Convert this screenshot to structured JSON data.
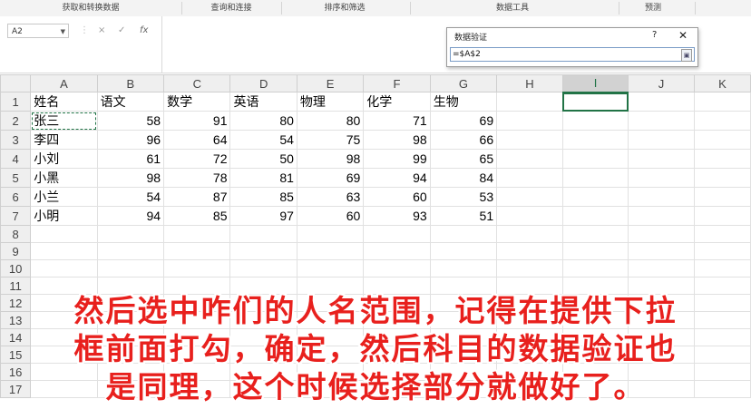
{
  "ribbon": {
    "groups": [
      "获取和转换数据",
      "查询和连接",
      "排序和筛选",
      "数据工具",
      "预测"
    ]
  },
  "formula_bar": {
    "name_box": "A2",
    "cancel_icon": "×",
    "enter_icon": "✓",
    "fx_label": "fx",
    "formula": ""
  },
  "dialog": {
    "title": "数据验证",
    "help": "?",
    "close": "✕",
    "reference": "=$A$2"
  },
  "columns": [
    "A",
    "B",
    "C",
    "D",
    "E",
    "F",
    "G",
    "H",
    "I",
    "J",
    "K"
  ],
  "rows": [
    {
      "n": "1",
      "cells": [
        "姓名",
        "语文",
        "数学",
        "英语",
        "物理",
        "化学",
        "生物"
      ]
    },
    {
      "n": "2",
      "cells": [
        "张三",
        "58",
        "91",
        "80",
        "80",
        "71",
        "69"
      ]
    },
    {
      "n": "3",
      "cells": [
        "李四",
        "96",
        "64",
        "54",
        "75",
        "98",
        "66"
      ]
    },
    {
      "n": "4",
      "cells": [
        "小刘",
        "61",
        "72",
        "50",
        "98",
        "99",
        "65"
      ]
    },
    {
      "n": "5",
      "cells": [
        "小黑",
        "98",
        "78",
        "81",
        "69",
        "94",
        "84"
      ]
    },
    {
      "n": "6",
      "cells": [
        "小兰",
        "54",
        "87",
        "85",
        "63",
        "60",
        "53"
      ]
    },
    {
      "n": "7",
      "cells": [
        "小明",
        "94",
        "85",
        "97",
        "60",
        "93",
        "51"
      ]
    },
    {
      "n": "8",
      "cells": []
    },
    {
      "n": "9",
      "cells": []
    },
    {
      "n": "10",
      "cells": []
    },
    {
      "n": "11",
      "cells": []
    },
    {
      "n": "12",
      "cells": []
    },
    {
      "n": "13",
      "cells": []
    },
    {
      "n": "14",
      "cells": []
    },
    {
      "n": "15",
      "cells": []
    },
    {
      "n": "16",
      "cells": []
    },
    {
      "n": "17",
      "cells": []
    }
  ],
  "caption": [
    "然后选中咋们的人名范围，记得在提供下拉",
    "框前面打勾，确定，然后科目的数据验证也",
    "是同理，这个时候选择部分就做好了。"
  ],
  "colors": {
    "accent": "#217346",
    "caption": "#e8201d"
  }
}
